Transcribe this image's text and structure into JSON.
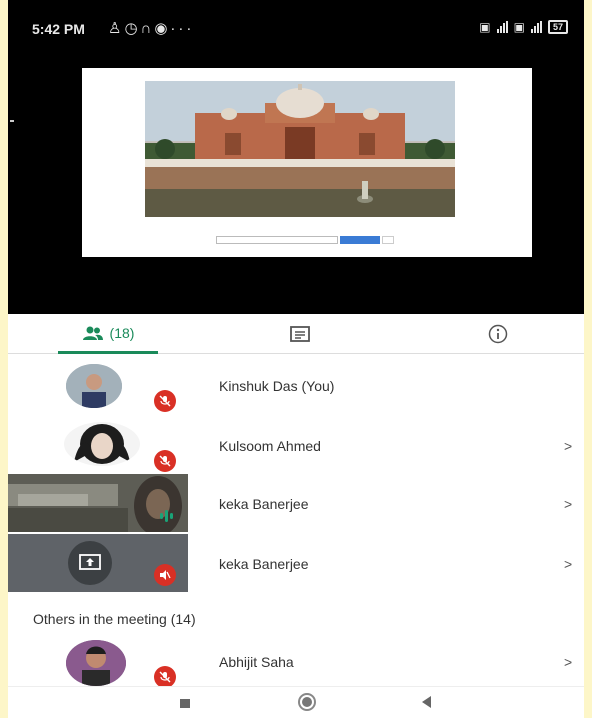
{
  "status_bar": {
    "time": "5:42 PM",
    "left_icons": [
      "notification-icon",
      "alarm-icon",
      "headset-icon",
      "app-icon",
      "more-icon"
    ],
    "left_more": "···",
    "battery_level": "57"
  },
  "tabs": {
    "people_count": "(18)",
    "active": "people"
  },
  "participants": [
    {
      "name": "Kinshuk Das (You)",
      "muted": true,
      "has_arrow": false
    },
    {
      "name": "Kulsoom Ahmed",
      "muted": true,
      "has_arrow": true,
      "arrow": ">"
    },
    {
      "name": "keka Banerjee",
      "speaking": true,
      "has_arrow": true,
      "arrow": ">"
    },
    {
      "name": "keka Banerjee",
      "presenting": true,
      "muted": true,
      "has_arrow": true,
      "arrow": ">"
    }
  ],
  "others_section": {
    "title": "Others in the meeting (14)",
    "items": [
      {
        "name": "Abhijit Saha",
        "muted": true,
        "arrow": ">"
      }
    ]
  },
  "colors": {
    "accent": "#1a8a5a",
    "muted_red": "#d93025",
    "speaking_green": "#1aa377",
    "presenter_tile": "#5f6368"
  }
}
